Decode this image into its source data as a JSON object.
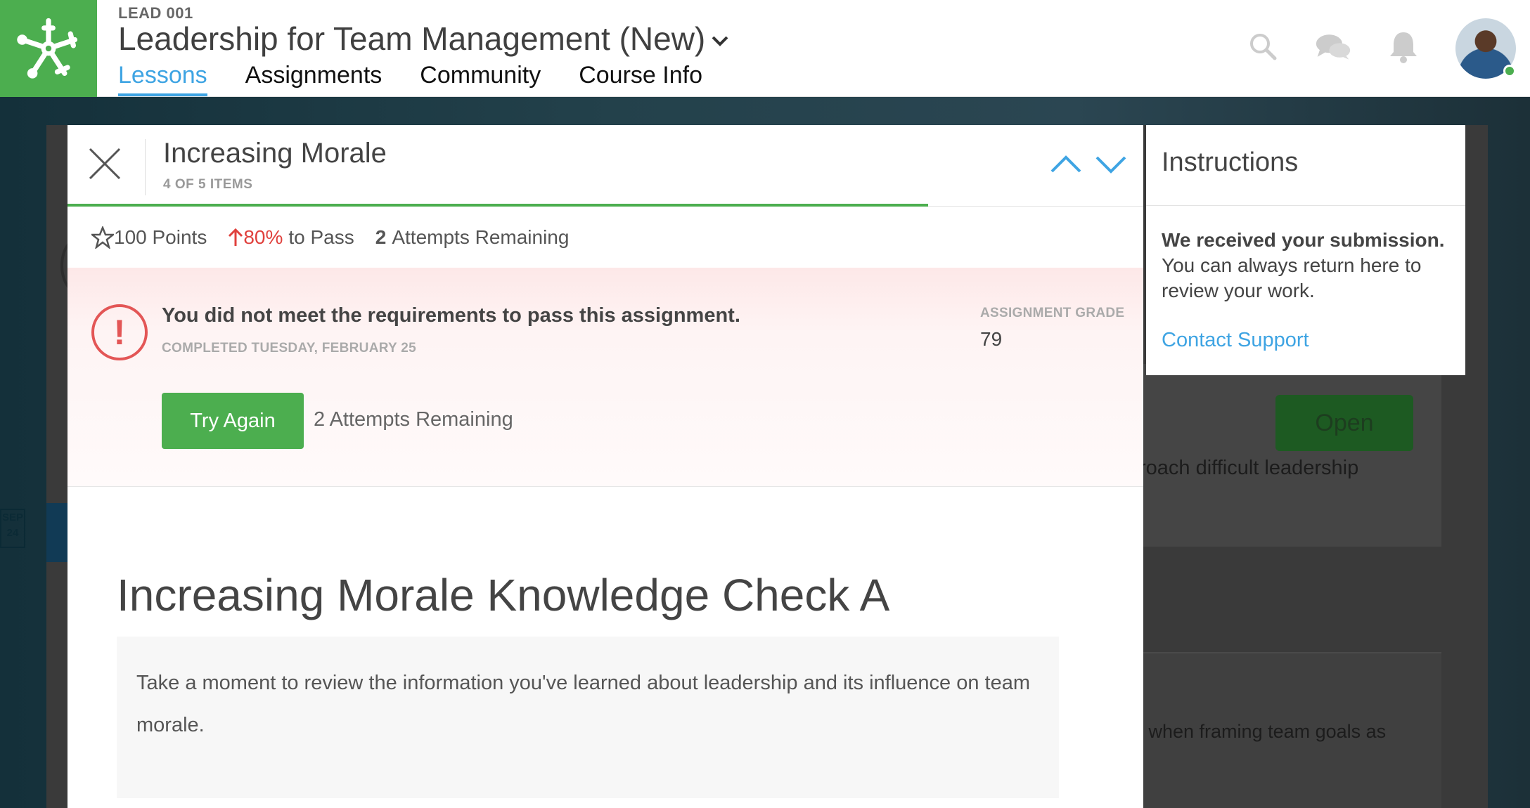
{
  "header": {
    "course_code": "LEAD 001",
    "course_title": "Leadership for Team Management (New)",
    "tabs": [
      {
        "label": "Lessons",
        "active": true
      },
      {
        "label": "Assignments",
        "active": false
      },
      {
        "label": "Community",
        "active": false
      },
      {
        "label": "Course Info",
        "active": false
      }
    ],
    "icons": [
      "search-icon",
      "chat-icon",
      "bell-icon"
    ],
    "brand_color": "#4cae4f",
    "accent_color": "#3ea4e3"
  },
  "background": {
    "open_label": "Open",
    "text_snippet_1": "roach difficult leadership",
    "text_snippet_2": "l when framing team goals as",
    "date_badge_month": "SEP",
    "date_badge_day": "24"
  },
  "modal": {
    "title": "Increasing Morale",
    "item_count": "4 OF 5 ITEMS",
    "progress_fraction": 0.8,
    "points_label": "100 Points",
    "pass_percent": "80%",
    "pass_suffix": "to Pass",
    "attempts_number": "2",
    "attempts_suffix": "Attempts Remaining",
    "fail_message": "You did not meet the requirements to pass this assignment.",
    "completed_date": "COMPLETED TUESDAY, FEBRUARY 25",
    "grade_label": "ASSIGNMENT GRADE",
    "grade_value": "79",
    "try_again_label": "Try Again",
    "try_again_note": "2 Attempts Remaining",
    "content_title": "Increasing Morale Knowledge Check A",
    "content_text": "Take a moment to review the information you've learned about leadership and its influence on team morale."
  },
  "instructions": {
    "title": "Instructions",
    "bold_text": "We received your submission.",
    "body_text": "You can always return here to review your work.",
    "link_label": "Contact Support"
  }
}
